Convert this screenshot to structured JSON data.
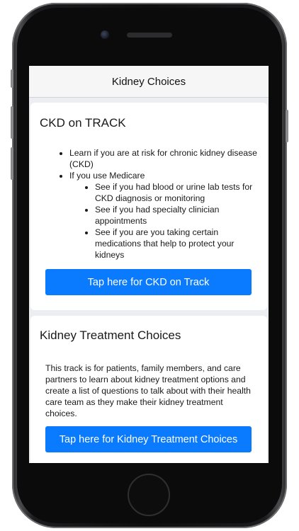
{
  "app": {
    "title": "Kidney Choices"
  },
  "ckd_card": {
    "title": "CKD on TRACK",
    "bullets": [
      {
        "text": "Learn if you are at risk for chronic kidney disease (CKD)"
      },
      {
        "text": "If you use Medicare",
        "sub": [
          "See if you had blood or urine lab tests for CKD diagnosis or monitoring",
          "See if you had specialty clinician appointments",
          "See if you are you taking certain medications that help to protect your kidneys"
        ]
      }
    ],
    "button_label": "Tap here for CKD on Track"
  },
  "treatment_card": {
    "title": "Kidney Treatment Choices",
    "description": "This track is for patients, family members, and care partners to learn about kidney treatment options and create a list of questions to talk about with their health care team as they make their kidney treatment choices.",
    "button_label": "Tap here for Kidney Treatment Choices"
  },
  "colors": {
    "accent": "#0a7bff",
    "screen_background": "#eceef1",
    "card_background": "#ffffff"
  }
}
